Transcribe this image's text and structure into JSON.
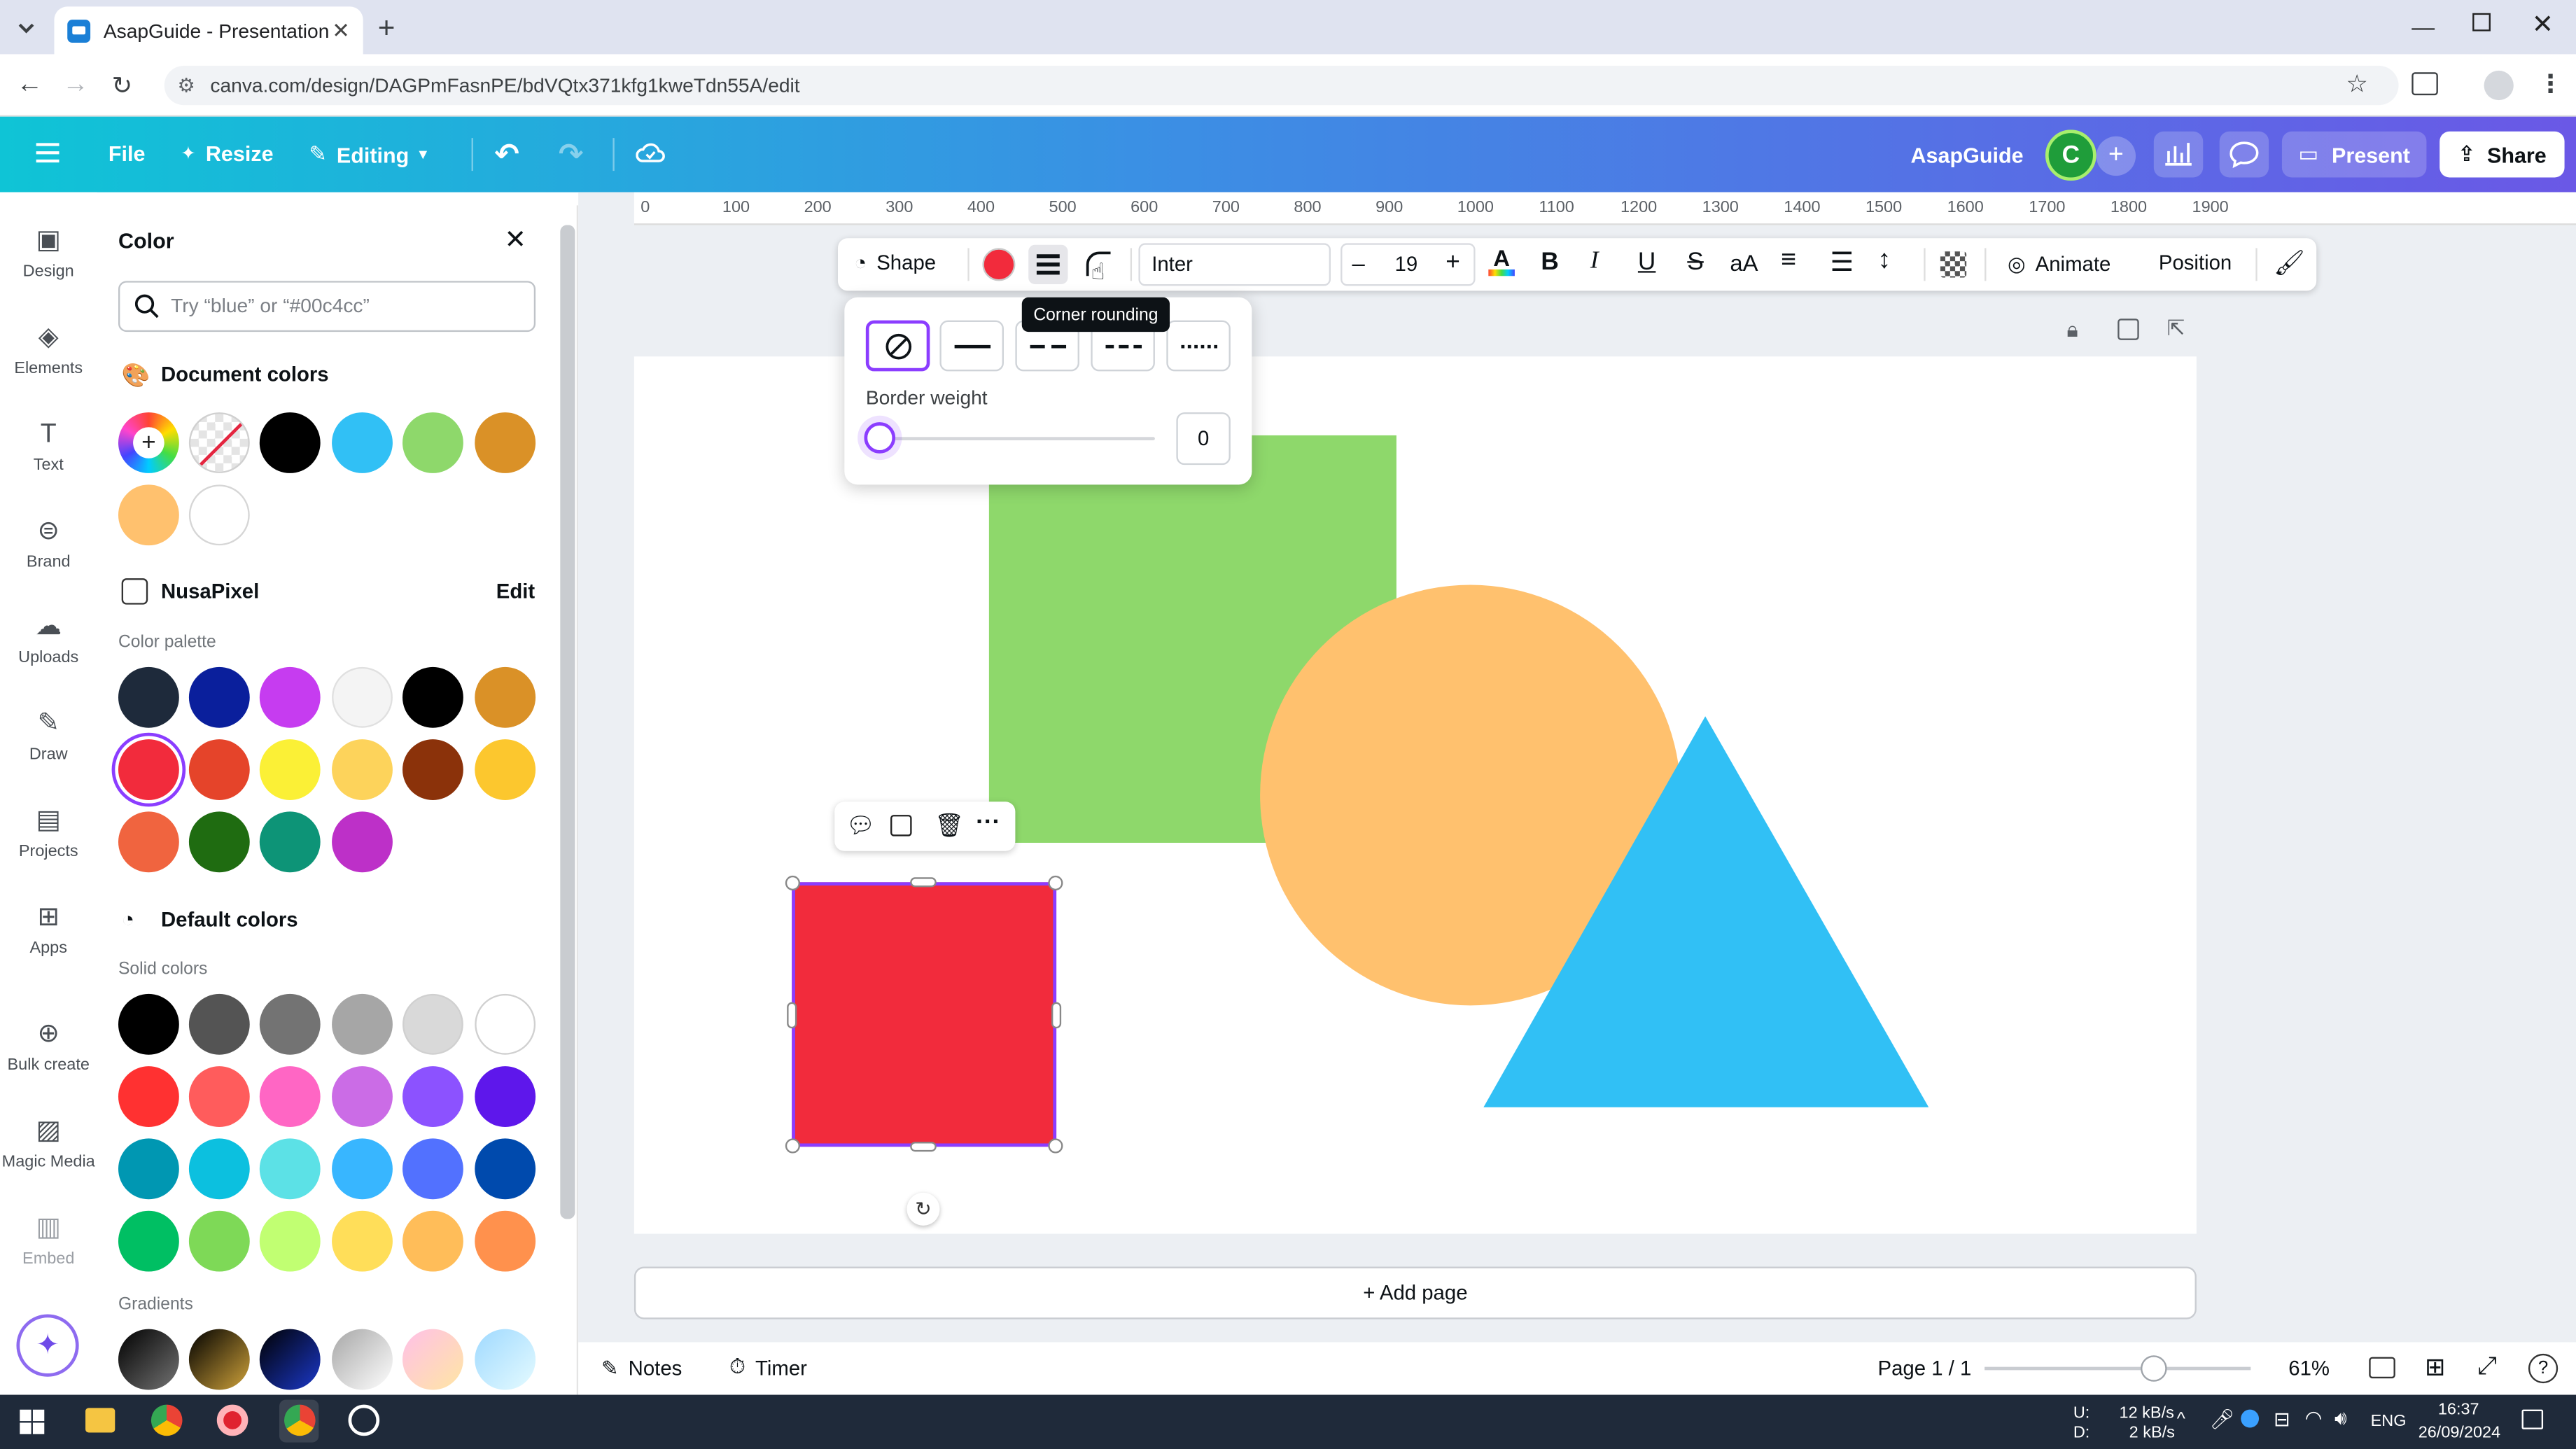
{
  "browser": {
    "tab_title": "AsapGuide - Presentation",
    "url": "canva.com/design/DAGPmFasnPE/bdVQtx371kfg1kweTdn55A/edit"
  },
  "header": {
    "file_label": "File",
    "resize_label": "Resize",
    "editing_label": "Editing",
    "brand_name": "AsapGuide",
    "avatar_letter": "C",
    "present_label": "Present",
    "share_label": "Share"
  },
  "rail": {
    "items": [
      {
        "label": "Design",
        "icon": "design-icon"
      },
      {
        "label": "Elements",
        "icon": "elements-icon"
      },
      {
        "label": "Text",
        "icon": "text-icon"
      },
      {
        "label": "Brand",
        "icon": "brand-icon"
      },
      {
        "label": "Uploads",
        "icon": "uploads-icon"
      },
      {
        "label": "Draw",
        "icon": "draw-icon"
      },
      {
        "label": "Projects",
        "icon": "projects-icon"
      },
      {
        "label": "Apps",
        "icon": "apps-icon"
      },
      {
        "label": "Bulk create",
        "icon": "bulk-create-icon"
      },
      {
        "label": "Magic Media",
        "icon": "magic-media-icon"
      },
      {
        "label": "Embed",
        "icon": "embed-icon"
      }
    ]
  },
  "color_panel": {
    "title": "Color",
    "search_placeholder": "Try “blue” or “#00c4cc”",
    "document_colors_heading": "Document colors",
    "document_colors": [
      "#000000",
      "#31c0f5",
      "#8ed86b",
      "#da9127",
      "#ffc16e",
      "#ffffff"
    ],
    "brand_kit_name": "NusaPixel",
    "edit_label": "Edit",
    "palette_label": "Color palette",
    "palette": [
      "#1e2a3b",
      "#0a1f9c",
      "#c63cf0",
      "#f4f4f4",
      "#000000",
      "#da9127",
      "#f22b3c",
      "#e5442a",
      "#fbf036",
      "#fdd35b",
      "#8b320a",
      "#fcc72e",
      "#f0643f",
      "#1f6c11",
      "#0d9477",
      "#bd30c8"
    ],
    "default_colors_heading": "Default colors",
    "solid_label": "Solid colors",
    "solid_colors": [
      "#000000",
      "#545454",
      "#737373",
      "#a6a6a6",
      "#d9d9d9",
      "#ffffff",
      "#ff3131",
      "#ff5c5c",
      "#ff66c4",
      "#cb6ce6",
      "#8c52ff",
      "#5e17eb",
      "#0097b2",
      "#0cc0df",
      "#5ce1e6",
      "#38b6ff",
      "#5271ff",
      "#004aad",
      "#00bf63",
      "#7ed957",
      "#c1ff72",
      "#ffde59",
      "#ffbd59",
      "#ff914d"
    ],
    "gradients_label": "Gradients"
  },
  "ruler": {
    "ticks": [
      "0",
      "100",
      "200",
      "300",
      "400",
      "500",
      "600",
      "700",
      "800",
      "900",
      "1000",
      "1100",
      "1200",
      "1300",
      "1400",
      "1500",
      "1600",
      "1700",
      "1800",
      "1900"
    ]
  },
  "toolbar": {
    "shape_label": "Shape",
    "fill_color": "#f22b3c",
    "font": "Inter",
    "font_size": "19",
    "animate_label": "Animate",
    "position_label": "Position"
  },
  "tooltip": "Corner rounding",
  "border_popup": {
    "weight_label": "Border weight",
    "weight_value": "0"
  },
  "add_page_label": "+ Add page",
  "footer": {
    "notes_label": "Notes",
    "timer_label": "Timer",
    "page_indicator": "Page 1 / 1",
    "zoom": "61%",
    "zoom_level": 0.61
  },
  "taskbar": {
    "upload_speed": "12 kB/s",
    "download_speed": "2 kB/s",
    "upload_label": "U:",
    "download_label": "D:",
    "language": "ENG",
    "time": "16:37",
    "date": "26/09/2024"
  }
}
